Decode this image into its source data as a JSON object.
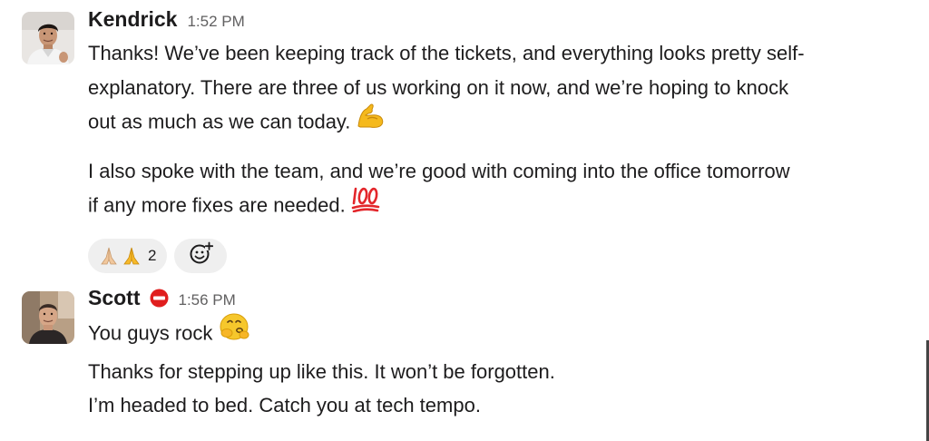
{
  "messages": [
    {
      "author": "Kendrick",
      "time": "1:52 PM",
      "paragraphs": [
        {
          "lines": [
            "Thanks! We’ve been keeping track of the tickets, and everything looks pretty self-",
            "explanatory. There are three of us working on it now, and we’re hoping to knock",
            "out as much as we can today."
          ],
          "trailing_emoji": "flexed-biceps-emoji"
        },
        {
          "lines": [
            "I also spoke with the team, and we’re good with coming into the office tomorrow",
            "if any more fixes are needed."
          ],
          "trailing_emoji": "hundred-points-emoji"
        }
      ],
      "reactions": [
        {
          "emojis": [
            "folded-hands-light-skin-emoji",
            "folded-hands-emoji"
          ],
          "count": "2"
        }
      ],
      "add_reaction_icon": "add-reaction-icon"
    },
    {
      "author": "Scott",
      "status_icon": "no-entry-icon",
      "time": "1:56 PM",
      "lines": [
        "You guys rock",
        "Thanks for stepping up like this. It won’t be forgotten.",
        "I’m headed to bed. Catch you at tech tempo."
      ],
      "first_line_emoji": "shy-face-emoji"
    }
  ],
  "colors": {
    "text": "#1d1c1d",
    "timestamp": "#616061",
    "reaction_bg": "#efefef",
    "status_red": "#e01e1e"
  }
}
